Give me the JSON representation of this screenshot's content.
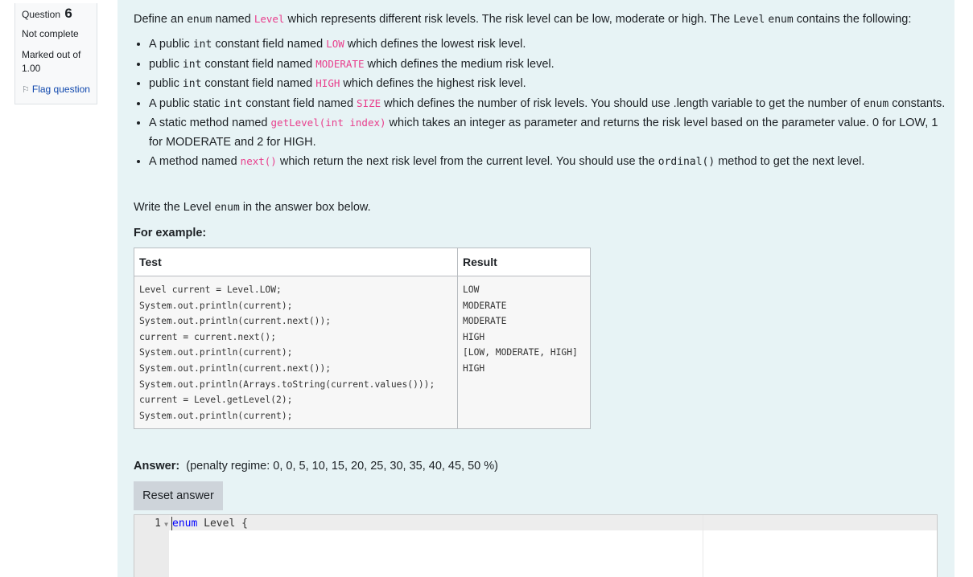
{
  "info": {
    "question_label": "Question",
    "question_number": "6",
    "state": "Not complete",
    "grade_line1": "Marked out of",
    "grade_line2": "1.00",
    "flag_label": "Flag question"
  },
  "question": {
    "intro_a": "Define an ",
    "intro_enum": "enum",
    "intro_b": " named ",
    "intro_level": "Level",
    "intro_c": " which represents different risk levels. The risk level can be low, moderate or high. The ",
    "intro_level2": "Level",
    "intro_d": " ",
    "intro_enum2": "enum",
    "intro_e": " contains the following:",
    "bullets": {
      "b1": {
        "pre": "A public ",
        "type": "int",
        "mid": " constant field named ",
        "name": "LOW",
        "post": " which defines the lowest risk level."
      },
      "b2": {
        "pre": "public ",
        "type": "int",
        "mid": " constant field named ",
        "name": "MODERATE",
        "post": " which defines the medium risk level."
      },
      "b3": {
        "pre": "public ",
        "type": "int",
        "mid": " constant field named ",
        "name": "HIGH",
        "post": " which defines the highest risk level."
      },
      "b4": {
        "pre": "A public static ",
        "type": "int",
        "mid": " constant field named ",
        "name": "SIZE",
        "post": " which defines the number of risk levels. You should use .length variable to get the number of ",
        "tail_code": "enum",
        "tail": " constants."
      },
      "b5": {
        "pre": "A static method named ",
        "name": "getLevel(int index)",
        "post": " which takes an integer as parameter and returns the risk level based on the parameter value. 0 for LOW, 1 for MODERATE and 2 for HIGH."
      },
      "b6": {
        "pre": "A method named ",
        "name": "next()",
        "post": " which return the next risk level from the current level. You should use the ",
        "code": "ordinal()",
        "tail": " method to get the next level."
      }
    },
    "write_a": "Write the Level ",
    "write_enum": "enum",
    "write_b": " in the answer box below.",
    "for_example": "For example:"
  },
  "example_table": {
    "header_test": "Test",
    "header_result": "Result",
    "test_lines": [
      "Level current = Level.LOW;",
      "System.out.println(current);",
      "System.out.println(current.next());",
      "current = current.next();",
      "System.out.println(current);",
      "System.out.println(current.next());",
      "System.out.println(Arrays.toString(current.values()));",
      "current = Level.getLevel(2);",
      "System.out.println(current);"
    ],
    "result_lines": [
      "LOW",
      "MODERATE",
      "MODERATE",
      "HIGH",
      "[LOW, MODERATE, HIGH]",
      "HIGH"
    ]
  },
  "answer": {
    "label": "Answer:",
    "regime": "(penalty regime: 0, 0, 5, 10, 15, 20, 25, 30, 35, 40, 45, 50 %)",
    "reset_label": "Reset answer"
  },
  "editor": {
    "line_number": "1",
    "fold_glyph": "▼",
    "keyword": "enum",
    "rest": " Level {"
  }
}
